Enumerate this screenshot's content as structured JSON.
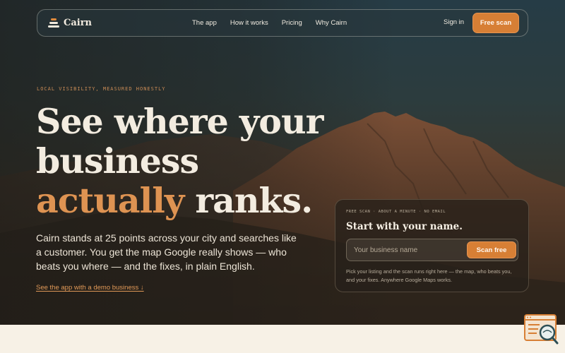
{
  "brand": {
    "name": "Cairn"
  },
  "nav": {
    "links": [
      "The app",
      "How it works",
      "Pricing",
      "Why Cairn"
    ],
    "signin": "Sign in",
    "cta": "Free scan"
  },
  "hero": {
    "eyebrow": "LOCAL VISIBILITY, MEASURED HONESTLY",
    "headline_line1": "See where your",
    "headline_line2": "business",
    "headline_accent": "actually",
    "headline_end": " ranks.",
    "lead": "Cairn stands at 25 points across your city and searches like a customer. You get the map Google really shows — who beats you where — and the fixes, in plain English.",
    "demo_link": "See the app with a demo business ↓"
  },
  "scan_card": {
    "eyebrow": "FREE SCAN · ABOUT A MINUTE · NO EMAIL",
    "title": "Start with your name.",
    "input_placeholder": "Your business name",
    "input_value": "",
    "button": "Scan free",
    "note": "Pick your listing and the scan runs right here — the map, who beats you, and your fixes. Anywhere Google Maps works."
  },
  "colors": {
    "accent": "#d77f35",
    "accent_text": "#de9352",
    "cream": "#f7f1e6"
  },
  "icons": {
    "logo": "stacked-stones-icon",
    "widget": "search-page-icon"
  }
}
